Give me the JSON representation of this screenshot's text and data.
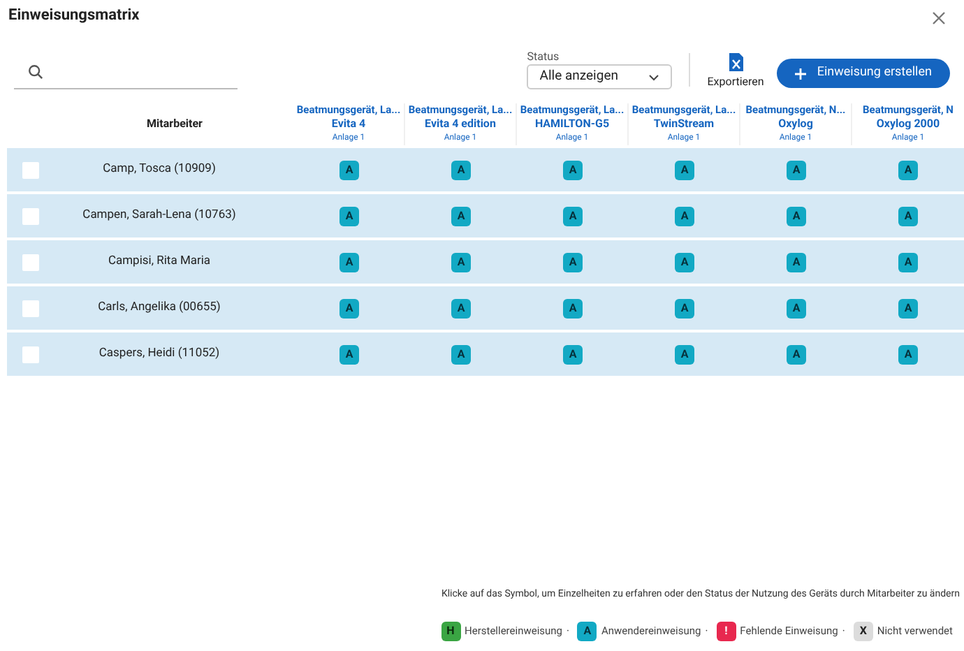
{
  "window": {
    "title": "Einweisungsmatrix"
  },
  "status_filter": {
    "label": "Status",
    "value": "Alle anzeigen"
  },
  "export": {
    "label": "Exportieren"
  },
  "create_button": {
    "label": "Einweisung erstellen"
  },
  "table": {
    "employee_header": "Mitarbeiter",
    "devices": [
      {
        "type": "Beatmungsgerät, La...",
        "name": "Evita 4",
        "location": "Anlage 1"
      },
      {
        "type": "Beatmungsgerät, La...",
        "name": "Evita 4 edition",
        "location": "Anlage 1"
      },
      {
        "type": "Beatmungsgerät, La...",
        "name": "HAMILTON-G5",
        "location": "Anlage 1"
      },
      {
        "type": "Beatmungsgerät, La...",
        "name": "TwinStream",
        "location": "Anlage 1"
      },
      {
        "type": "Beatmungsgerät, N...",
        "name": "Oxylog",
        "location": "Anlage 1"
      },
      {
        "type": "Beatmungsgerät, N",
        "name": "Oxylog 2000",
        "location": "Anlage 1"
      }
    ],
    "rows": [
      {
        "name": "Camp, Tosca (10909)",
        "checked": false,
        "cells": [
          {
            "kind": "user",
            "label": "A"
          },
          {
            "kind": "user",
            "label": "A"
          },
          {
            "kind": "user",
            "label": "A"
          },
          {
            "kind": "user",
            "label": "A"
          },
          {
            "kind": "user",
            "label": "A"
          },
          {
            "kind": "user",
            "label": "A"
          }
        ]
      },
      {
        "name": "Campen, Sarah-Lena (10763)",
        "checked": false,
        "cells": [
          {
            "kind": "user",
            "label": "A"
          },
          {
            "kind": "user",
            "label": "A"
          },
          {
            "kind": "user",
            "label": "A"
          },
          {
            "kind": "user",
            "label": "A"
          },
          {
            "kind": "user",
            "label": "A"
          },
          {
            "kind": "user",
            "label": "A"
          }
        ]
      },
      {
        "name": "Campisi, Rita Maria",
        "checked": false,
        "cells": [
          {
            "kind": "user",
            "label": "A"
          },
          {
            "kind": "user",
            "label": "A"
          },
          {
            "kind": "user",
            "label": "A"
          },
          {
            "kind": "user",
            "label": "A"
          },
          {
            "kind": "user",
            "label": "A"
          },
          {
            "kind": "user",
            "label": "A"
          }
        ]
      },
      {
        "name": "Carls, Angelika (00655)",
        "checked": false,
        "cells": [
          {
            "kind": "user",
            "label": "A"
          },
          {
            "kind": "user",
            "label": "A"
          },
          {
            "kind": "user",
            "label": "A"
          },
          {
            "kind": "user",
            "label": "A"
          },
          {
            "kind": "user",
            "label": "A"
          },
          {
            "kind": "user",
            "label": "A"
          }
        ]
      },
      {
        "name": "Caspers, Heidi (11052)",
        "checked": false,
        "cells": [
          {
            "kind": "user",
            "label": "A"
          },
          {
            "kind": "user",
            "label": "A"
          },
          {
            "kind": "user",
            "label": "A"
          },
          {
            "kind": "user",
            "label": "A"
          },
          {
            "kind": "user",
            "label": "A"
          },
          {
            "kind": "user",
            "label": "A"
          }
        ]
      }
    ]
  },
  "hint": "Klicke auf das Symbol, um Einzelheiten zu erfahren oder den Status der Nutzung des Geräts durch Mitarbeiter zu ändern",
  "legend": [
    {
      "kind": "manufacturer",
      "symbol": "H",
      "label": "Herstellereinweisung",
      "separator": "·"
    },
    {
      "kind": "user",
      "symbol": "A",
      "label": "Anwendereinweisung",
      "separator": "·"
    },
    {
      "kind": "missing",
      "symbol": "!",
      "label": "Fehlende Einweisung",
      "separator": "·"
    },
    {
      "kind": "unused",
      "symbol": "X",
      "label": "Nicht verwendet"
    }
  ]
}
